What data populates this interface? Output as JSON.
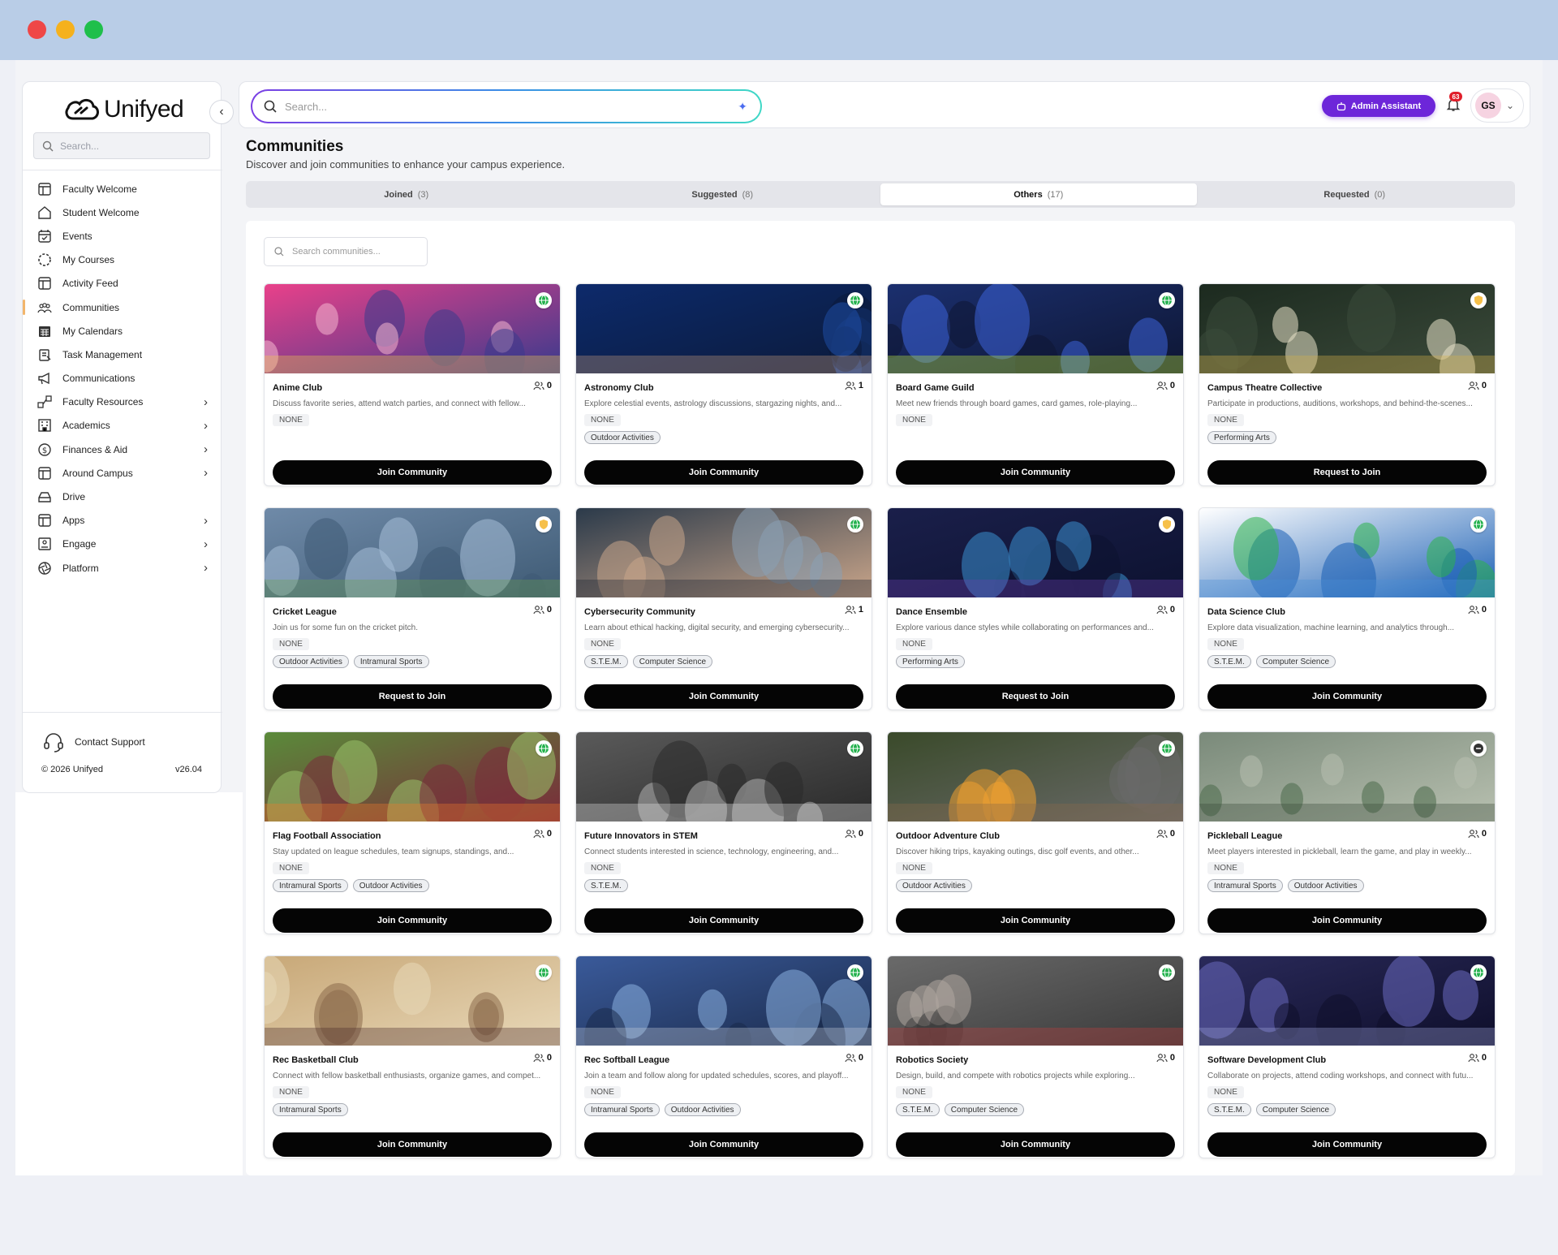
{
  "brand": {
    "name": "Unifyed"
  },
  "sidebar": {
    "search_placeholder": "Search...",
    "items": [
      {
        "label": "Faculty Welcome",
        "icon": "layout-icon",
        "chevron": false,
        "active": false
      },
      {
        "label": "Student Welcome",
        "icon": "home-icon",
        "chevron": false,
        "active": false
      },
      {
        "label": "Events",
        "icon": "calendar-check-icon",
        "chevron": false,
        "active": false
      },
      {
        "label": "My Courses",
        "icon": "dashed-circle-icon",
        "chevron": false,
        "active": false
      },
      {
        "label": "Activity Feed",
        "icon": "layout-icon",
        "chevron": false,
        "active": false
      },
      {
        "label": "Communities",
        "icon": "people-group-icon",
        "chevron": false,
        "active": true
      },
      {
        "label": "My Calendars",
        "icon": "calendar-grid-icon",
        "chevron": false,
        "active": false
      },
      {
        "label": "Task Management",
        "icon": "clipboard-icon",
        "chevron": false,
        "active": false
      },
      {
        "label": "Communications",
        "icon": "megaphone-icon",
        "chevron": false,
        "active": false
      },
      {
        "label": "Faculty Resources",
        "icon": "nodes-icon",
        "chevron": true,
        "active": false
      },
      {
        "label": "Academics",
        "icon": "building-icon",
        "chevron": true,
        "active": false
      },
      {
        "label": "Finances & Aid",
        "icon": "dollar-circle-icon",
        "chevron": true,
        "active": false
      },
      {
        "label": "Around Campus",
        "icon": "layout-icon",
        "chevron": true,
        "active": false
      },
      {
        "label": "Drive",
        "icon": "drive-icon",
        "chevron": false,
        "active": false
      },
      {
        "label": "Apps",
        "icon": "layout-icon",
        "chevron": true,
        "active": false
      },
      {
        "label": "Engage",
        "icon": "id-card-icon",
        "chevron": true,
        "active": false
      },
      {
        "label": "Platform",
        "icon": "aperture-icon",
        "chevron": true,
        "active": false
      }
    ],
    "support_label": "Contact Support",
    "copyright": "© 2026 Unifyed",
    "version": "v26.04"
  },
  "topbar": {
    "search_placeholder": "Search...",
    "admin_assistant_label": "Admin Assistant",
    "notification_count": "63",
    "user_initials": "GS"
  },
  "page": {
    "title": "Communities",
    "subtitle": "Discover and join communities to enhance your campus experience."
  },
  "tabs": [
    {
      "label": "Joined",
      "count": "(3)",
      "active": false
    },
    {
      "label": "Suggested",
      "count": "(8)",
      "active": false
    },
    {
      "label": "Others",
      "count": "(17)",
      "active": true
    },
    {
      "label": "Requested",
      "count": "(0)",
      "active": false
    }
  ],
  "community_search_placeholder": "Search communities...",
  "colors": {
    "accent": "#6d26d9",
    "active_indicator": "#f2b56b",
    "public": "#22b14c",
    "private": "#e6a817"
  },
  "cards": [
    {
      "title": "Anime Club",
      "members": "0",
      "description": "Discuss favorite series, attend watch parties, and connect with fellow...",
      "category": "NONE",
      "tags": [],
      "button": "Join Community",
      "visibility": "public",
      "palette": [
        "#e9418a",
        "#f6b6d0",
        "#3a3a8c",
        "#f2c94c"
      ]
    },
    {
      "title": "Astronomy Club",
      "members": "1",
      "description": "Explore celestial events, astrology discussions, stargazing nights, and...",
      "category": "NONE",
      "tags": [
        "Outdoor Activities"
      ],
      "button": "Join Community",
      "visibility": "public",
      "palette": [
        "#0d2a6b",
        "#1f4fa8",
        "#0b1a3a",
        "#c79b7a"
      ]
    },
    {
      "title": "Board Game Guild",
      "members": "0",
      "description": "Meet new friends through board games, card games, role-playing...",
      "category": "NONE",
      "tags": [],
      "button": "Join Community",
      "visibility": "public",
      "palette": [
        "#1b2f6e",
        "#3c63d9",
        "#0e1633",
        "#c7f03c"
      ]
    },
    {
      "title": "Campus Theatre Collective",
      "members": "0",
      "description": "Participate in productions, auditions, workshops, and behind-the-scenes...",
      "category": "NONE",
      "tags": [
        "Performing Arts"
      ],
      "button": "Request to Join",
      "visibility": "private",
      "palette": [
        "#1c2a1f",
        "#e8e2c8",
        "#3b4a3a",
        "#d8b34a"
      ]
    },
    {
      "title": "Cricket League",
      "members": "0",
      "description": "Join us for some fun on the cricket pitch.",
      "category": "NONE",
      "tags": [
        "Outdoor Activities",
        "Intramural Sports"
      ],
      "button": "Request to Join",
      "visibility": "private",
      "palette": [
        "#6f8aa8",
        "#a8c0d8",
        "#3e5a74",
        "#6a9e4f"
      ]
    },
    {
      "title": "Cybersecurity Community",
      "members": "1",
      "description": "Learn about ethical hacking, digital security, and emerging cybersecurity...",
      "category": "NONE",
      "tags": [
        "S.T.E.M.",
        "Computer Science"
      ],
      "button": "Join Community",
      "visibility": "public",
      "palette": [
        "#2b3a4a",
        "#8aa0b4",
        "#c9a58a",
        "#1a2230"
      ]
    },
    {
      "title": "Dance Ensemble",
      "members": "0",
      "description": "Explore various dance styles while collaborating on performances and...",
      "category": "NONE",
      "tags": [
        "Performing Arts"
      ],
      "button": "Request to Join",
      "visibility": "private",
      "palette": [
        "#1a1f4a",
        "#3a8fd0",
        "#0d1230",
        "#6a3fb0"
      ]
    },
    {
      "title": "Data Science Club",
      "members": "0",
      "description": "Explore data visualization, machine learning, and analytics through...",
      "category": "NONE",
      "tags": [
        "S.T.E.M.",
        "Computer Science"
      ],
      "button": "Join Community",
      "visibility": "public",
      "palette": [
        "#ffffff",
        "#2bb34a",
        "#1a5fb4",
        "#4a8fd8"
      ]
    },
    {
      "title": "Flag Football Association",
      "members": "0",
      "description": "Stay updated on league schedules, team signups, standings, and...",
      "category": "NONE",
      "tags": [
        "Intramural Sports",
        "Outdoor Activities"
      ],
      "button": "Join Community",
      "visibility": "public",
      "palette": [
        "#5a8a3a",
        "#9bc26a",
        "#7a2a3a",
        "#f07a2a"
      ]
    },
    {
      "title": "Future Innovators in STEM",
      "members": "0",
      "description": "Connect students interested in science, technology, engineering, and...",
      "category": "NONE",
      "tags": [
        "S.T.E.M."
      ],
      "button": "Join Community",
      "visibility": "public",
      "palette": [
        "#5a5a5a",
        "#b0b0b0",
        "#2a2a2a",
        "#e0e0e0"
      ]
    },
    {
      "title": "Outdoor Adventure Club",
      "members": "0",
      "description": "Discover hiking trips, kayaking outings, disc golf events, and other...",
      "category": "NONE",
      "tags": [
        "Outdoor Activities"
      ],
      "button": "Join Community",
      "visibility": "public",
      "palette": [
        "#3a4a2a",
        "#f0a030",
        "#6a6a6a",
        "#8a6a4a"
      ]
    },
    {
      "title": "Pickleball League",
      "members": "0",
      "description": "Meet players interested in pickleball, learn the game, and play in weekly...",
      "category": "NONE",
      "tags": [
        "Intramural Sports",
        "Outdoor Activities"
      ],
      "button": "Join Community",
      "visibility": "none",
      "palette": [
        "#7a8a7a",
        "#4a6a4a",
        "#b8c0b0",
        "#3a4a3a"
      ]
    },
    {
      "title": "Rec Basketball Club",
      "members": "0",
      "description": "Connect with fellow basketball enthusiasts, organize games, and compet...",
      "category": "NONE",
      "tags": [
        "Intramural Sports"
      ],
      "button": "Join Community",
      "visibility": "public",
      "palette": [
        "#c8a878",
        "#8a6a4a",
        "#e8d8b8",
        "#4a2a2a"
      ]
    },
    {
      "title": "Rec Softball League",
      "members": "0",
      "description": "Join a team and follow along for updated schedules, scores, and playoff...",
      "category": "NONE",
      "tags": [
        "Intramural Sports",
        "Outdoor Activities"
      ],
      "button": "Join Community",
      "visibility": "public",
      "palette": [
        "#3a5a9a",
        "#8ab0e0",
        "#1a2a4a",
        "#c0c8d8"
      ]
    },
    {
      "title": "Robotics Society",
      "members": "0",
      "description": "Design, build, and compete with robotics projects while exploring...",
      "category": "NONE",
      "tags": [
        "S.T.E.M.",
        "Computer Science"
      ],
      "button": "Join Community",
      "visibility": "public",
      "palette": [
        "#6a6a6a",
        "#b0a8a0",
        "#3a3a3a",
        "#c04040"
      ]
    },
    {
      "title": "Software Development Club",
      "members": "0",
      "description": "Collaborate on projects, attend coding workshops, and connect with futu...",
      "category": "NONE",
      "tags": [
        "S.T.E.M.",
        "Computer Science"
      ],
      "button": "Join Community",
      "visibility": "public",
      "palette": [
        "#2a2a5a",
        "#6a6ac0",
        "#0e0e2a",
        "#9aa0d8"
      ]
    }
  ]
}
